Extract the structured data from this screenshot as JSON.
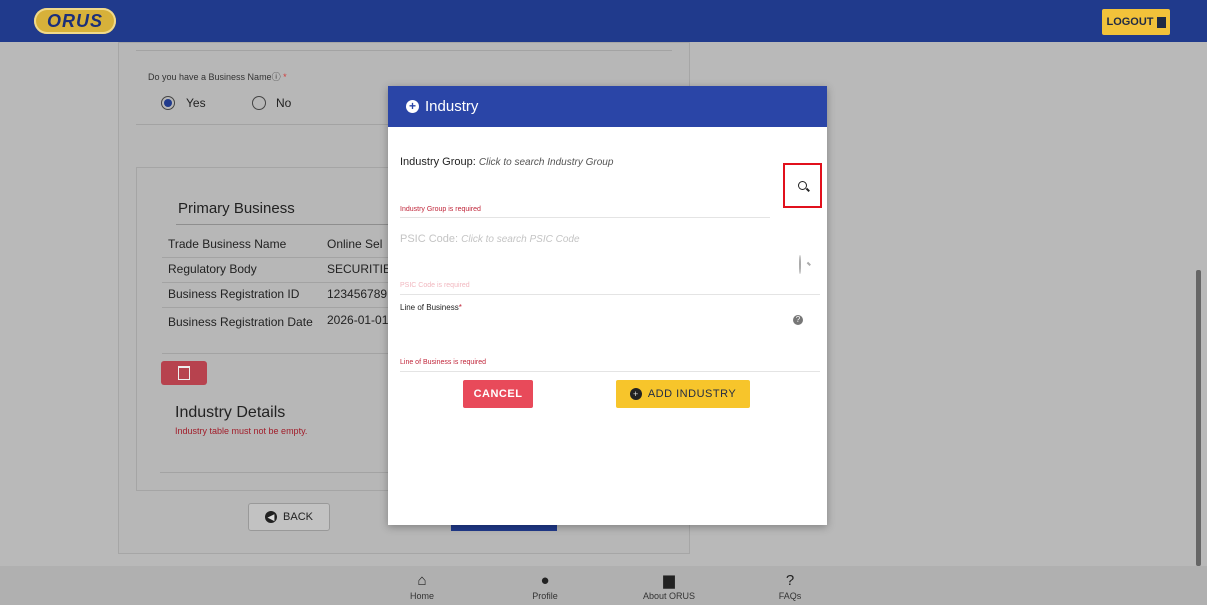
{
  "header": {
    "logo_text": "ORUS",
    "logout_label": "LOGOUT"
  },
  "form": {
    "business_name_question": "Do you have a Business Name",
    "required_marker": "*",
    "options": [
      "Yes",
      "No"
    ],
    "selected": "Yes"
  },
  "primary_business": {
    "title": "Primary Business",
    "rows": [
      {
        "label": "Trade Business Name",
        "value": "Online Sel"
      },
      {
        "label": "Regulatory Body",
        "value": "SECURITIE"
      },
      {
        "label": "Business Registration ID",
        "value": "123456789"
      },
      {
        "label": "Business Registration Date",
        "value": "2026-01-01"
      }
    ]
  },
  "industry_details": {
    "title": "Industry Details",
    "error": "Industry table must not be empty."
  },
  "back_button": "BACK",
  "modal": {
    "title": "Industry",
    "industry_group_label": "Industry Group:",
    "industry_group_hint": "Click to search Industry Group",
    "industry_group_error": "Industry Group is required",
    "psic_label": "PSIC Code:",
    "psic_hint": "Click to search PSIC Code",
    "psic_error": "PSIC Code is required",
    "lob_label": "Line of Business",
    "lob_error": "Line of Business is required",
    "cancel_label": "CANCEL",
    "add_label": "ADD INDUSTRY"
  },
  "footer": {
    "items": [
      "Home",
      "Profile",
      "About ORUS",
      "FAQs"
    ]
  },
  "colors": {
    "brand_blue": "#2a45a7",
    "accent_yellow": "#f7c52b",
    "danger": "#e84a5a",
    "highlight": "#e1101c"
  }
}
